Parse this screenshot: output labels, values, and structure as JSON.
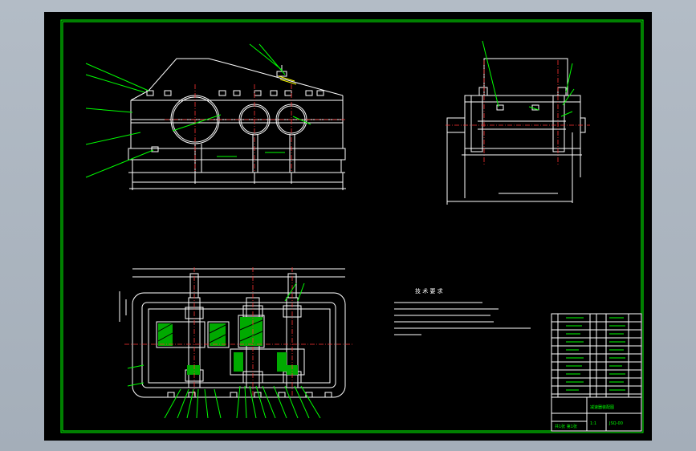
{
  "drawing": {
    "notes_heading": "技 术 要 求",
    "title_block": {
      "title": "减速器装配图",
      "drawing_no": "JSQ-00",
      "scale": "1:1",
      "sheet": "共1张 第1张"
    }
  },
  "colors": {
    "background": "#000000",
    "frame": "#00ff00",
    "outline": "#ffffff",
    "hidden": "#ffff00",
    "center": "#ff3333",
    "hatch": "#00ff00"
  }
}
